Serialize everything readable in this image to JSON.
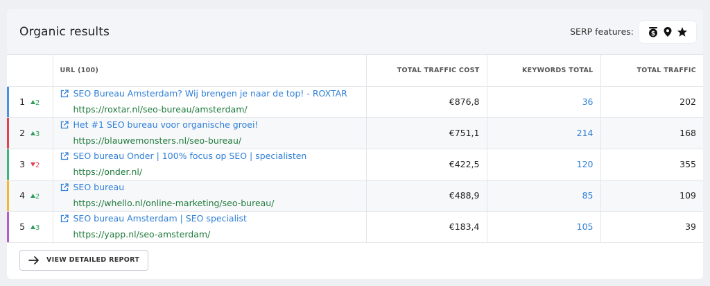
{
  "panel": {
    "title": "Organic results",
    "serp_label": "SERP features:",
    "serp_icons": [
      "dollar-badge-icon",
      "map-pin-icon",
      "star-icon"
    ]
  },
  "table": {
    "headers": {
      "url": "URL (100)",
      "traffic_cost": "TOTAL TRAFFIC COST",
      "keywords": "KEYWORDS TOTAL",
      "traffic": "TOTAL TRAFFIC"
    },
    "rows": [
      {
        "rank": "1",
        "delta": "2",
        "trend": "up",
        "bar_color": "#4a90e2",
        "title": "SEO Bureau Amsterdam? Wij brengen je naar de top! - ROXTAR",
        "url": "https://roxtar.nl/seo-bureau/amsterdam/",
        "cost": "€876,8",
        "keywords": "36",
        "traffic": "202"
      },
      {
        "rank": "2",
        "delta": "3",
        "trend": "up",
        "bar_color": "#e0404f",
        "title": "Het #1 SEO bureau voor organische groei!",
        "url": "https://blauwemonsters.nl/seo-bureau/",
        "cost": "€751,1",
        "keywords": "214",
        "traffic": "168"
      },
      {
        "rank": "3",
        "delta": "2",
        "trend": "down",
        "bar_color": "#3bb37a",
        "title": "SEO bureau Onder | 100% focus op SEO | specialisten",
        "url": "https://onder.nl/",
        "cost": "€422,5",
        "keywords": "120",
        "traffic": "355"
      },
      {
        "rank": "4",
        "delta": "2",
        "trend": "up",
        "bar_color": "#f2b632",
        "title": "SEO bureau",
        "url": "https://whello.nl/online-marketing/seo-bureau/",
        "cost": "€488,9",
        "keywords": "85",
        "traffic": "109"
      },
      {
        "rank": "5",
        "delta": "3",
        "trend": "up",
        "bar_color": "#b45cc8",
        "title": "SEO bureau Amsterdam | SEO specialist",
        "url": "https://yapp.nl/seo-amsterdam/",
        "cost": "€183,4",
        "keywords": "105",
        "traffic": "39"
      }
    ]
  },
  "footer": {
    "button_label": "VIEW DETAILED REPORT"
  }
}
